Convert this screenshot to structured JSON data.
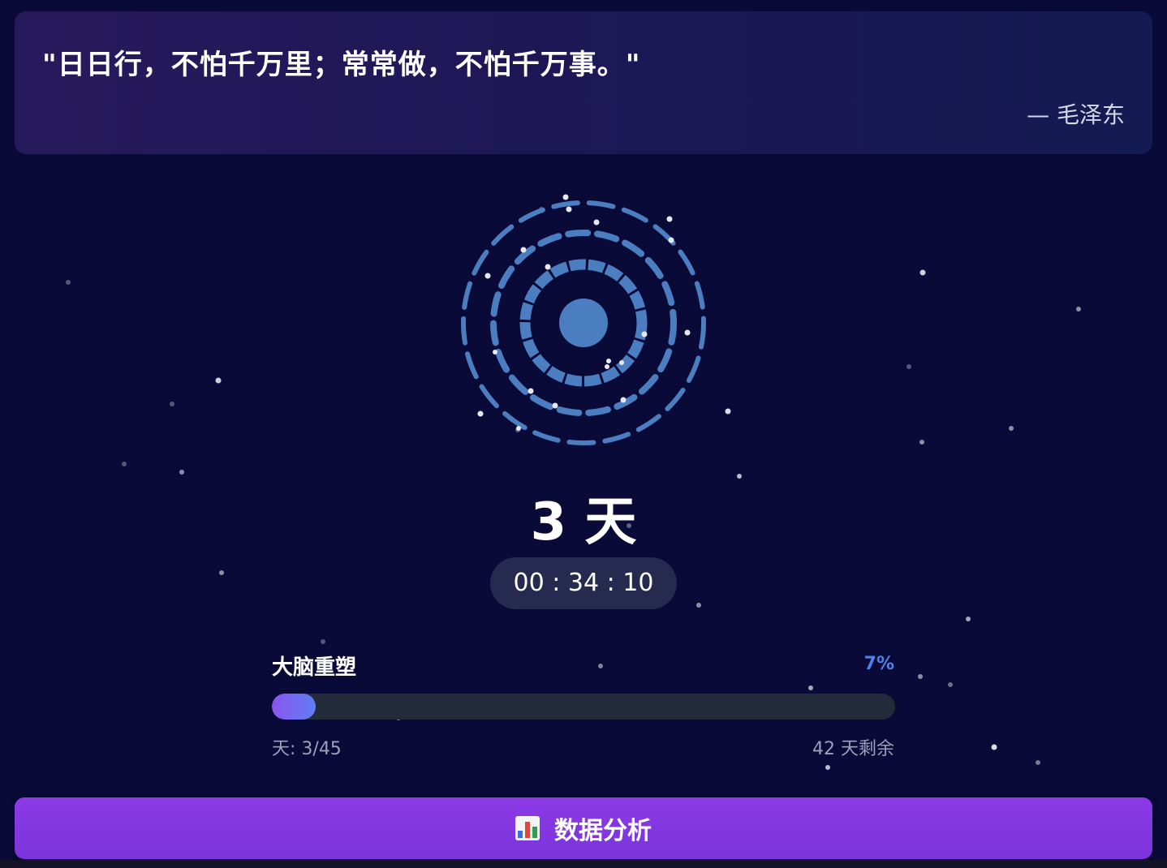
{
  "quote": {
    "text": "\"日日行，不怕千万里；常常做，不怕千万事。\"",
    "author": "— 毛泽东"
  },
  "countdown": {
    "days_text": "3 天",
    "timer_text": "00 : 34 : 10"
  },
  "progress": {
    "title": "大脑重塑",
    "percent_label": "7%",
    "percent_value": 7,
    "days_label": "天: 3/45",
    "remaining_label": "42 天剩余"
  },
  "actions": {
    "analysis_label": "数据分析",
    "analysis_icon": "bar-chart-icon"
  },
  "colors": {
    "background": "#0a0a38",
    "ring": "#4a7ec0",
    "accent_purple": "#8a3ae4",
    "progress_start": "#8a56ee",
    "progress_end": "#5f7ef2",
    "percent_text": "#4f82e8"
  }
}
